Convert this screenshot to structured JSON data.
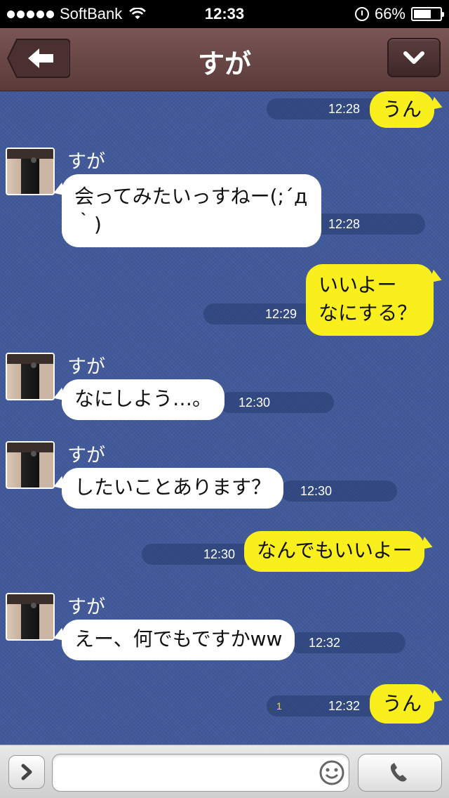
{
  "status_bar": {
    "carrier": "SoftBank",
    "time": "12:33",
    "battery": "66%",
    "battery_level": 0.66
  },
  "header": {
    "title": "すが"
  },
  "messages": [
    {
      "dir": "out",
      "text": "うん",
      "time": "12:28"
    },
    {
      "dir": "in",
      "sender": "すが",
      "text1": "会ってみたいっすねー(;´д",
      "text2": "｀)",
      "time": "12:28"
    },
    {
      "dir": "out",
      "text1": "いいよー",
      "text2": "なにする？",
      "time": "12:29"
    },
    {
      "dir": "in",
      "sender": "すが",
      "text": "なにしよう…。",
      "time": "12:30"
    },
    {
      "dir": "in",
      "sender": "すが",
      "text": "したいことあります？",
      "time": "12:30"
    },
    {
      "dir": "out",
      "text": "なんでもいいよー",
      "time": "12:30"
    },
    {
      "dir": "in",
      "sender": "すが",
      "text": "えー、何でもですかww",
      "time": "12:32"
    },
    {
      "dir": "out",
      "text": "うん",
      "time": "12:32",
      "read": "1"
    }
  ],
  "input": {
    "placeholder": ""
  },
  "icons": {
    "back": "back-arrow-icon",
    "menu": "chevron-down-icon",
    "expand": "chevron-right-icon",
    "emoji": "smiley-icon",
    "call": "phone-icon"
  },
  "colors": {
    "chat_bg": "#41599a",
    "outgoing": "#f8ef1d",
    "incoming": "#ffffff",
    "header": "#6a4646"
  }
}
